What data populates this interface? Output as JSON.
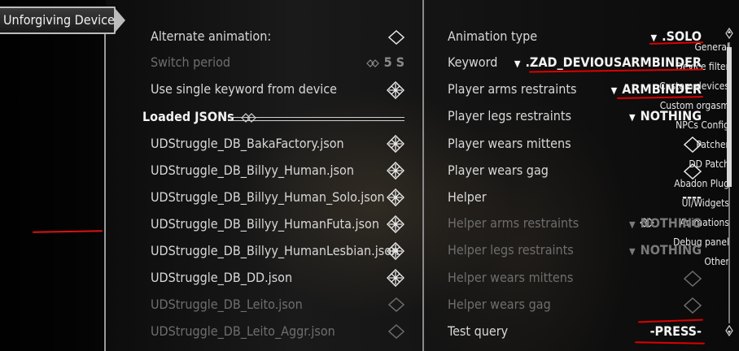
{
  "header": {
    "title": "Unforgiving Devices"
  },
  "sidebar": {
    "items": [
      {
        "label": "General"
      },
      {
        "label": "Device filter"
      },
      {
        "label": "Custom devices"
      },
      {
        "label": "Custom orgasm"
      },
      {
        "label": "NPCs Config"
      },
      {
        "label": "Patcher"
      },
      {
        "label": "DD Patch"
      },
      {
        "label": "Abadon Plug"
      },
      {
        "label": "UI/Widgets"
      },
      {
        "label": "Animations"
      },
      {
        "label": "Debug panel"
      },
      {
        "label": "Other"
      }
    ],
    "active_index": 9
  },
  "middle": {
    "alternate_animation": {
      "label": "Alternate animation:",
      "checked": false
    },
    "switch_period": {
      "label": "Switch period",
      "value": "5 S"
    },
    "single_keyword": {
      "label": "Use single keyword from device",
      "checked": true
    },
    "loaded_jsons_header": "Loaded JSONs",
    "jsons": [
      {
        "label": "UDStruggle_DB_BakaFactory.json",
        "checked": true,
        "enabled": true
      },
      {
        "label": "UDStruggle_DB_Billyy_Human.json",
        "checked": true,
        "enabled": true
      },
      {
        "label": "UDStruggle_DB_Billyy_Human_Solo.json",
        "checked": true,
        "enabled": true
      },
      {
        "label": "UDStruggle_DB_Billyy_HumanFuta.json",
        "checked": true,
        "enabled": true
      },
      {
        "label": "UDStruggle_DB_Billyy_HumanLesbian.json",
        "checked": true,
        "enabled": true
      },
      {
        "label": "UDStruggle_DB_DD.json",
        "checked": true,
        "enabled": true
      },
      {
        "label": "UDStruggle_DB_Leito.json",
        "checked": false,
        "enabled": false
      },
      {
        "label": "UDStruggle_DB_Leito_Aggr.json",
        "checked": false,
        "enabled": false
      }
    ]
  },
  "right": {
    "animation_type": {
      "label": "Animation type",
      "value": ".SOLO"
    },
    "keyword": {
      "label": "Keyword",
      "value": ".ZAD_DEVIOUSARMBINDER"
    },
    "player_arms": {
      "label": "Player arms restraints",
      "value": "ARMBINDER"
    },
    "player_legs": {
      "label": "Player legs restraints",
      "value": "NOTHING"
    },
    "player_mittens": {
      "label": "Player wears mittens"
    },
    "player_gag": {
      "label": "Player wears gag"
    },
    "helper": {
      "label": "Helper",
      "value": "----"
    },
    "helper_arms": {
      "label": "Helper arms restraints",
      "value": "NOTHING"
    },
    "helper_legs": {
      "label": "Helper legs restraints",
      "value": "NOTHING"
    },
    "helper_mittens": {
      "label": "Helper wears mittens"
    },
    "helper_gag": {
      "label": "Helper wears gag"
    },
    "test_query": {
      "label": "Test query",
      "value": "-PRESS-"
    }
  },
  "colors": {
    "highlight_underline": "#dd0000",
    "text": "#dcdcdc",
    "disabled": "#6e6e6e"
  }
}
